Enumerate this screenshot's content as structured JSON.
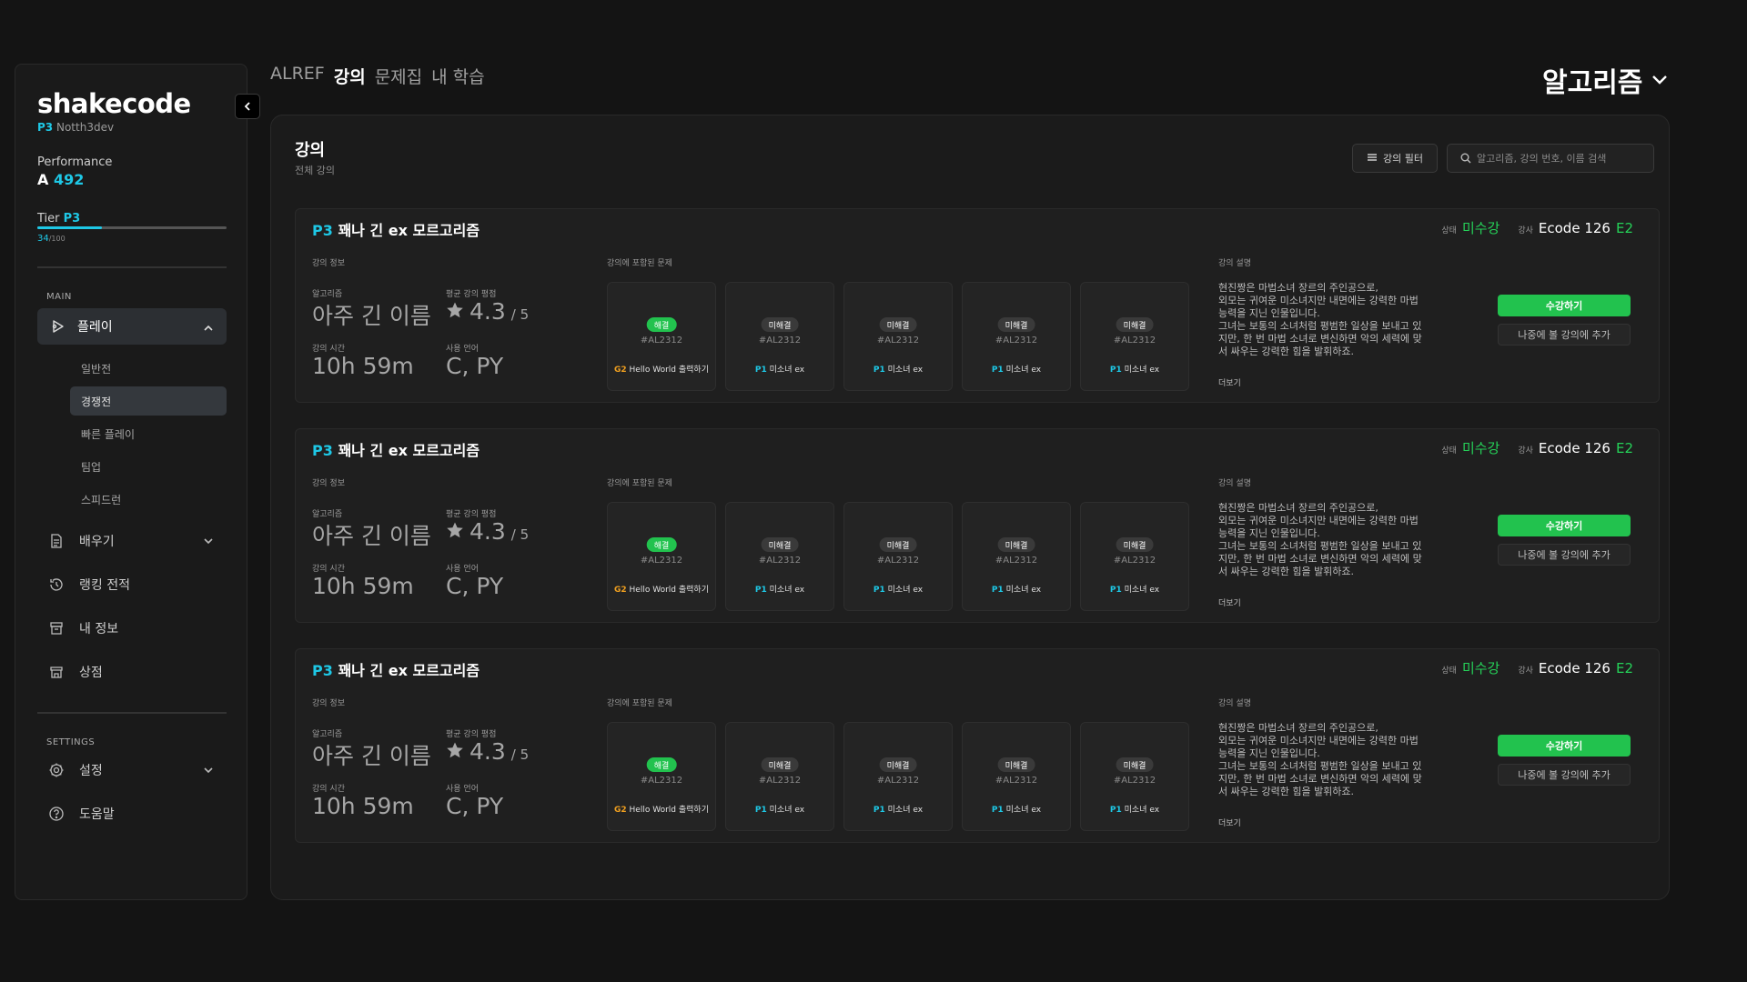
{
  "sidebar": {
    "brand": "shakecode",
    "user_tier": "P3",
    "username": "Notth3dev",
    "performance_label": "Performance",
    "performance_grade": "A",
    "performance_value": "492",
    "tier_label": "Tier",
    "tier_value": "P3",
    "tier_progress": "34",
    "tier_max": "/100",
    "tier_fraction": 0.34,
    "main_label": "MAIN",
    "play_label": "플레이",
    "play_sub": [
      "일반전",
      "경쟁전",
      "빠른 플레이",
      "팀업",
      "스피드런"
    ],
    "learn_label": "배우기",
    "ranking_label": "랭킹 전적",
    "myinfo_label": "내 정보",
    "shop_label": "상점",
    "settings_section": "SETTINGS",
    "settings_label": "설정",
    "help_label": "도움말"
  },
  "topnav": {
    "tabs": [
      "ALREF",
      "강의",
      "문제집",
      "내 학습"
    ],
    "active": "강의",
    "category": "알고리즘"
  },
  "main": {
    "title": "강의",
    "subtitle": "전체 강의",
    "filter_label": "강의 필터",
    "search_placeholder": "알고리즘, 강의 번호, 이름 검색"
  },
  "courses": [
    {
      "tier": "P3",
      "title": "꽤나 긴 ex 모르고리즘",
      "status_label": "상태",
      "status": "미수강",
      "instructor_label": "강사",
      "instructor": "Ecode 126",
      "instructor_grade": "E2",
      "info_header": "강의 정보",
      "algo_label": "알고리즘",
      "algo": "아주 긴 이름",
      "rating_label": "평균 강의 평점",
      "rating": "4.3",
      "rating_max": "/ 5",
      "time_label": "강의 시간",
      "time": "10h 59m",
      "lang_label": "사용 언어",
      "lang": "C, PY",
      "problems_header": "강의에 포함된 문제",
      "problems": [
        {
          "status": "해결",
          "code": "#AL2312",
          "tier": "G2",
          "name": "Hello World 출력하기"
        },
        {
          "status": "미해결",
          "code": "#AL2312",
          "tier": "P1",
          "name": "미소녀 ex"
        },
        {
          "status": "미해결",
          "code": "#AL2312",
          "tier": "P1",
          "name": "미소녀 ex"
        },
        {
          "status": "미해결",
          "code": "#AL2312",
          "tier": "P1",
          "name": "미소녀 ex"
        },
        {
          "status": "미해결",
          "code": "#AL2312",
          "tier": "P1",
          "name": "미소녀 ex"
        }
      ],
      "desc_header": "강의 설명",
      "desc_lines": [
        "현진짱은 마법소녀 장르의 주인공으로,",
        "외모는 귀여운 미소녀지만 내면에는 강력한 마법",
        "능력을 지닌 인물입니다.",
        "그녀는 보통의 소녀처럼 평범한 일상을 보내고 있",
        "지만, 한 번 마법 소녀로 변신하면 악의 세력에 맞",
        "서 싸우는 강력한 힘을 발휘하죠."
      ],
      "more_label": "더보기",
      "enroll_label": "수강하기",
      "later_label": "나중에 볼 강의에 추가"
    },
    {
      "tier": "P3",
      "title": "꽤나 긴 ex 모르고리즘",
      "status_label": "상태",
      "status": "미수강",
      "instructor_label": "강사",
      "instructor": "Ecode 126",
      "instructor_grade": "E2",
      "info_header": "강의 정보",
      "algo_label": "알고리즘",
      "algo": "아주 긴 이름",
      "rating_label": "평균 강의 평점",
      "rating": "4.3",
      "rating_max": "/ 5",
      "time_label": "강의 시간",
      "time": "10h 59m",
      "lang_label": "사용 언어",
      "lang": "C, PY",
      "problems_header": "강의에 포함된 문제",
      "problems": [
        {
          "status": "해결",
          "code": "#AL2312",
          "tier": "G2",
          "name": "Hello World 출력하기"
        },
        {
          "status": "미해결",
          "code": "#AL2312",
          "tier": "P1",
          "name": "미소녀 ex"
        },
        {
          "status": "미해결",
          "code": "#AL2312",
          "tier": "P1",
          "name": "미소녀 ex"
        },
        {
          "status": "미해결",
          "code": "#AL2312",
          "tier": "P1",
          "name": "미소녀 ex"
        },
        {
          "status": "미해결",
          "code": "#AL2312",
          "tier": "P1",
          "name": "미소녀 ex"
        }
      ],
      "desc_header": "강의 설명",
      "desc_lines": [
        "현진짱은 마법소녀 장르의 주인공으로,",
        "외모는 귀여운 미소녀지만 내면에는 강력한 마법",
        "능력을 지닌 인물입니다.",
        "그녀는 보통의 소녀처럼 평범한 일상을 보내고 있",
        "지만, 한 번 마법 소녀로 변신하면 악의 세력에 맞",
        "서 싸우는 강력한 힘을 발휘하죠."
      ],
      "more_label": "더보기",
      "enroll_label": "수강하기",
      "later_label": "나중에 볼 강의에 추가"
    },
    {
      "tier": "P3",
      "title": "꽤나 긴 ex 모르고리즘",
      "status_label": "상태",
      "status": "미수강",
      "instructor_label": "강사",
      "instructor": "Ecode 126",
      "instructor_grade": "E2",
      "info_header": "강의 정보",
      "algo_label": "알고리즘",
      "algo": "아주 긴 이름",
      "rating_label": "평균 강의 평점",
      "rating": "4.3",
      "rating_max": "/ 5",
      "time_label": "강의 시간",
      "time": "10h 59m",
      "lang_label": "사용 언어",
      "lang": "C, PY",
      "problems_header": "강의에 포함된 문제",
      "problems": [
        {
          "status": "해결",
          "code": "#AL2312",
          "tier": "G2",
          "name": "Hello World 출력하기"
        },
        {
          "status": "미해결",
          "code": "#AL2312",
          "tier": "P1",
          "name": "미소녀 ex"
        },
        {
          "status": "미해결",
          "code": "#AL2312",
          "tier": "P1",
          "name": "미소녀 ex"
        },
        {
          "status": "미해결",
          "code": "#AL2312",
          "tier": "P1",
          "name": "미소녀 ex"
        },
        {
          "status": "미해결",
          "code": "#AL2312",
          "tier": "P1",
          "name": "미소녀 ex"
        }
      ],
      "desc_header": "강의 설명",
      "desc_lines": [
        "현진짱은 마법소녀 장르의 주인공으로,",
        "외모는 귀여운 미소녀지만 내면에는 강력한 마법",
        "능력을 지닌 인물입니다.",
        "그녀는 보통의 소녀처럼 평범한 일상을 보내고 있",
        "지만, 한 번 마법 소녀로 변신하면 악의 세력에 맞",
        "서 싸우는 강력한 힘을 발휘하죠."
      ],
      "more_label": "더보기",
      "enroll_label": "수강하기",
      "later_label": "나중에 볼 강의에 추가"
    }
  ],
  "colors": {
    "accent_cyan": "#1ec8e6",
    "accent_green": "#22c24e",
    "tier_gold": "#f0a020",
    "background": "#141414"
  },
  "icons": {
    "collapse": "chevron-left-icon",
    "play": "play-icon",
    "learn": "document-icon",
    "ranking": "history-icon",
    "myinfo": "archive-icon",
    "shop": "shop-icon",
    "settings": "gear-icon",
    "help": "help-circle-icon",
    "filter": "filter-icon",
    "search": "search-icon",
    "rating": "star-icon"
  }
}
